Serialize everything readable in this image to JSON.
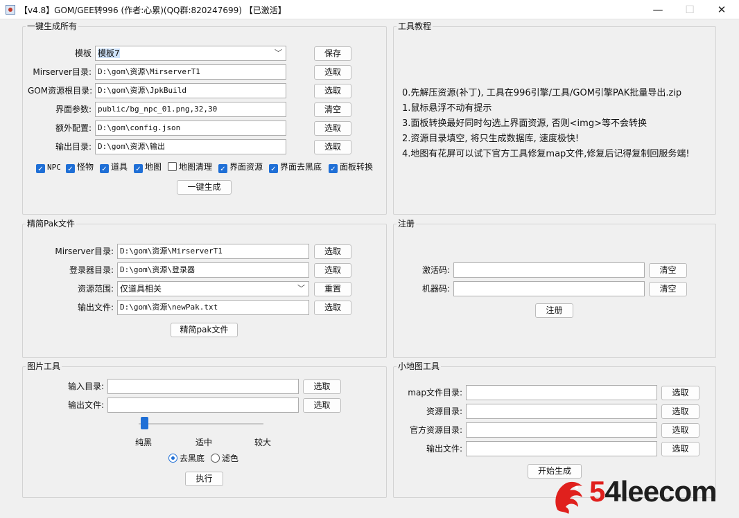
{
  "window": {
    "title": "【v4.8】GOM/GEE转996 (作者:心累)(QQ群:820247699)  【已激活】",
    "minimize_icon": "minimize-icon",
    "maximize_icon": "maximize-icon",
    "close_icon": "close-icon"
  },
  "generate_all": {
    "title": "一键生成所有",
    "rows": [
      {
        "label": "模板",
        "value": "模板7",
        "button": "保存"
      },
      {
        "label": "Mirserver目录:",
        "value": "D:\\gom\\资源\\MirserverT1",
        "button": "选取"
      },
      {
        "label": "GOM资源根目录:",
        "value": "D:\\gom\\资源\\JpkBuild",
        "button": "选取"
      },
      {
        "label": "界面参数:",
        "value": "public/bg_npc_01.png,32,30",
        "button": "清空"
      },
      {
        "label": "额外配置:",
        "value": "D:\\gom\\config.json",
        "button": "选取"
      },
      {
        "label": "输出目录:",
        "value": "D:\\gom\\资源\\输出",
        "button": "选取"
      }
    ],
    "checkboxes": [
      {
        "label": "NPC",
        "checked": true
      },
      {
        "label": "怪物",
        "checked": true
      },
      {
        "label": "道具",
        "checked": true
      },
      {
        "label": "地图",
        "checked": true
      },
      {
        "label": "地图清理",
        "checked": false
      },
      {
        "label": "界面资源",
        "checked": true
      },
      {
        "label": "界面去黑底",
        "checked": true
      },
      {
        "label": "面板转换",
        "checked": true
      }
    ],
    "action": "一键生成"
  },
  "tutorial": {
    "title": "工具教程",
    "lines": [
      "0.先解压资源(补丁), 工具在996引擎/工具/GOM引擎PAK批量导出.zip",
      "1.鼠标悬浮不动有提示",
      "3.面板转换最好同时勾选上界面资源, 否则<img>等不会转换",
      "2.资源目录填空, 将只生成数据库, 速度极快!",
      "4.地图有花屏可以试下官方工具修复map文件,修复后记得复制回服务端!"
    ]
  },
  "pak": {
    "title": "精简Pak文件",
    "rows": [
      {
        "label": "Mirserver目录:",
        "value": "D:\\gom\\资源\\MirserverT1",
        "button": "选取"
      },
      {
        "label": "登录器目录:",
        "value": "D:\\gom\\资源\\登录器",
        "button": "选取"
      },
      {
        "label": "资源范围:",
        "value": "仅道具相关",
        "button": "重置"
      },
      {
        "label": "输出文件:",
        "value": "D:\\gom\\资源\\newPak.txt",
        "button": "选取"
      }
    ],
    "action": "精简pak文件"
  },
  "register": {
    "title": "注册",
    "rows": [
      {
        "label": "激活码:",
        "value": "",
        "button": "清空"
      },
      {
        "label": "机器码:",
        "value": "",
        "button": "清空"
      }
    ],
    "action": "注册"
  },
  "image_tool": {
    "title": "图片工具",
    "rows": [
      {
        "label": "输入目录:",
        "value": "",
        "button": "选取"
      },
      {
        "label": "输出文件:",
        "value": "",
        "button": "选取"
      }
    ],
    "slider_ticks": [
      "纯黑",
      "适中",
      "较大"
    ],
    "slider_level": 0,
    "radios": [
      {
        "label": "去黑底",
        "selected": true
      },
      {
        "label": "滤色",
        "selected": false
      }
    ],
    "action": "执行"
  },
  "minimap": {
    "title": "小地图工具",
    "rows": [
      {
        "label": "map文件目录:",
        "value": "",
        "button": "选取"
      },
      {
        "label": "资源目录:",
        "value": "",
        "button": "选取"
      },
      {
        "label": "官方资源目录:",
        "value": "",
        "button": "选取"
      },
      {
        "label": "输出文件:",
        "value": "",
        "button": "选取"
      }
    ],
    "action": "开始生成"
  },
  "watermark": {
    "text": "54leecom",
    "colors": {
      "five": "#e0201d",
      "rest": "#1f1f1f"
    }
  }
}
